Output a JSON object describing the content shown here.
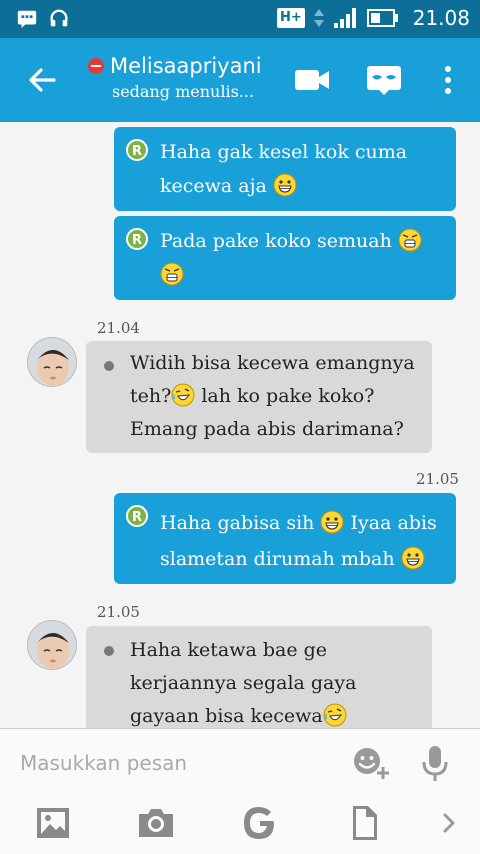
{
  "status_bar": {
    "network": "H+",
    "time": "21.08",
    "icons": [
      "bbm-chat-icon",
      "headset-icon",
      "signal-icon",
      "battery-icon"
    ]
  },
  "header": {
    "contact_name": "Melisaapriyani",
    "contact_status": "sedang menulis...",
    "actions": [
      "video-call-icon",
      "mask-icon",
      "overflow-menu-icon"
    ]
  },
  "messages": [
    {
      "dir": "out",
      "badge": "R",
      "lines": [
        "Haha gak kesel kok cuma",
        "kecewa aja"
      ]
    },
    {
      "dir": "out",
      "badge": "R",
      "lines": [
        "Pada pake koko semuah",
        ""
      ]
    },
    {
      "dir": "in",
      "time": "21.04",
      "lines": [
        "Widih bisa kecewa emangnya",
        "teh?",
        "lah ko pake koko?",
        "Emang pada abis darimana?"
      ]
    },
    {
      "dir": "out",
      "time": "21.05",
      "badge": "R",
      "lines": [
        "Haha gabisa sih",
        "Iyaa abis",
        "slametan dirumah mbah"
      ]
    },
    {
      "dir": "in",
      "time": "21.05",
      "lines": [
        "Haha ketawa bae ge",
        "kerjaannya segala gaya",
        "gayaan bisa kecewa"
      ]
    }
  ],
  "composer": {
    "placeholder": "Masukkan pesan",
    "toolbar": [
      "image-icon",
      "camera-icon",
      "google-icon",
      "file-icon",
      "chevron-right-icon"
    ]
  },
  "colors": {
    "status_bar": "#0d6e98",
    "app_bar": "#1aa0d8",
    "outgoing_bubble": "#1aa0d8",
    "incoming_bubble": "#d9d9d9",
    "read_badge": "#7cb342"
  }
}
